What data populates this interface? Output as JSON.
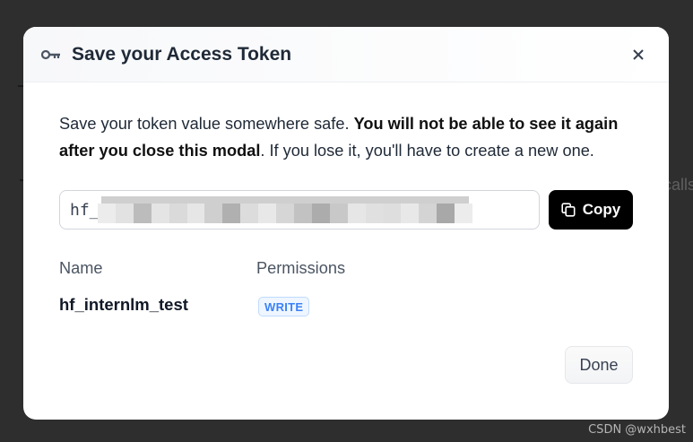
{
  "background": {
    "partial_text": "calls"
  },
  "watermark": "CSDN @wxhbest",
  "modal": {
    "title": "Save your Access Token",
    "title_icon": "key-icon",
    "close_icon": "close-icon",
    "message": {
      "plain_start": "Save your token value somewhere safe. ",
      "bold": "You will not be able to see it again after you close this modal",
      "plain_end": ". If you lose it, you'll have to create a new one."
    },
    "token": {
      "prefix": "hf_",
      "masked": true
    },
    "copy_button": {
      "label": "Copy",
      "icon": "copy-icon"
    },
    "table": {
      "headers": [
        "Name",
        "Permissions"
      ],
      "row": {
        "name": "hf_internlm_test",
        "permission": "WRITE"
      }
    },
    "done_button": {
      "label": "Done"
    }
  },
  "colors": {
    "overlay": "#2e2e2e",
    "primary_button": "#000000",
    "badge_text": "#3b82f6",
    "badge_bg": "#eff6ff"
  }
}
